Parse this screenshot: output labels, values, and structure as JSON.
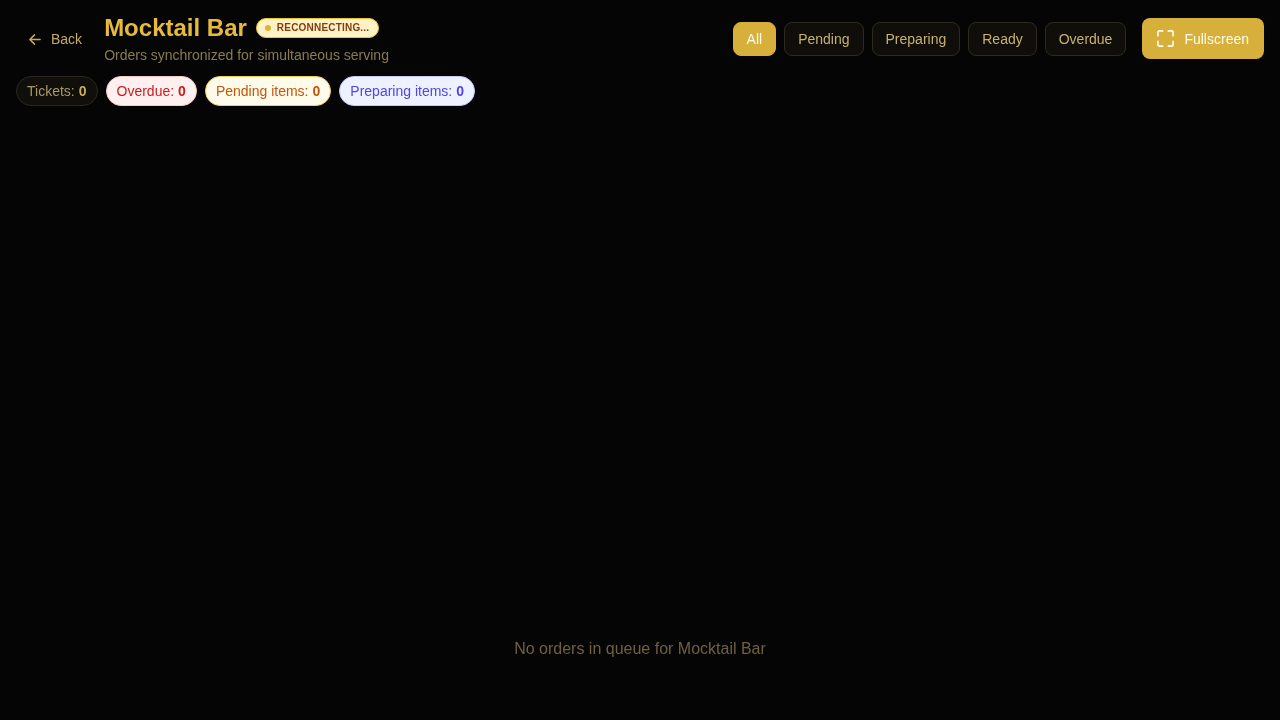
{
  "header": {
    "back": {
      "label": "Back"
    },
    "title": "Mocktail Bar",
    "connection": {
      "kind": "reconnecting",
      "label": "RECONNECTING..."
    },
    "subtitle": "Orders synchronized for simultaneous serving"
  },
  "filters": [
    {
      "label": "All",
      "selected": true
    },
    {
      "label": "Pending",
      "selected": false
    },
    {
      "label": "Preparing",
      "selected": false
    },
    {
      "label": "Ready",
      "selected": false
    },
    {
      "label": "Overdue",
      "selected": false
    }
  ],
  "fullscreen_button": {
    "label": "Fullscreen"
  },
  "stats": [
    {
      "kind": "neutral",
      "text": "Tickets: **0**"
    },
    {
      "kind": "danger",
      "text": "Overdue: **0**"
    },
    {
      "kind": "warning",
      "text": "Pending items: **0**"
    },
    {
      "kind": "info",
      "text": "Preparing items: **0**"
    }
  ],
  "empty_message": "No orders in queue for Mocktail Bar"
}
